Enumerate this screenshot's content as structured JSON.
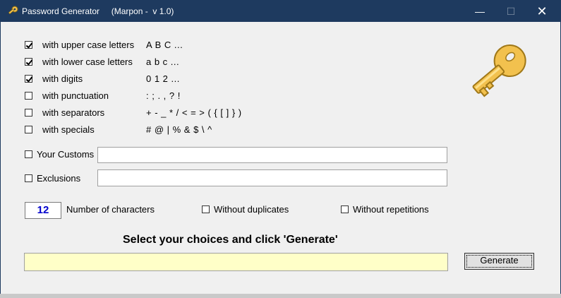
{
  "window": {
    "title": "Password Generator     (Marpon -  v 1.0)",
    "minimize_label": "—",
    "maximize_label": "☐",
    "close_label": "✕"
  },
  "options": [
    {
      "label": "with upper case letters",
      "chars": "A B C ...",
      "checked": true
    },
    {
      "label": "with lower case letters",
      "chars": "a b c ...",
      "checked": true
    },
    {
      "label": "with digits",
      "chars": "0 1 2 ...",
      "checked": true
    },
    {
      "label": "with punctuation",
      "chars": ": ; . , ? !",
      "checked": false
    },
    {
      "label": "with separators",
      "chars": "+ - _ * / < = > ( { [ ] } )",
      "checked": false
    },
    {
      "label": "with specials",
      "chars": "# @ | % & $ \\ ^",
      "checked": false
    }
  ],
  "customs": {
    "label": "Your Customs",
    "checked": false,
    "value": ""
  },
  "exclusions": {
    "label": "Exclusions",
    "checked": false,
    "value": ""
  },
  "length": {
    "value": "12",
    "label": "Number of characters"
  },
  "without_duplicates": {
    "label": "Without duplicates",
    "checked": false
  },
  "without_repetitions": {
    "label": "Without repetitions",
    "checked": false
  },
  "instruction": "Select your choices and click 'Generate'",
  "output": {
    "value": ""
  },
  "generate_button": "Generate",
  "colors": {
    "titlebar": "#1e3a5f",
    "output_bg": "#ffffc8",
    "number_text": "#0000cc",
    "key_gold": "#f2c14e"
  }
}
